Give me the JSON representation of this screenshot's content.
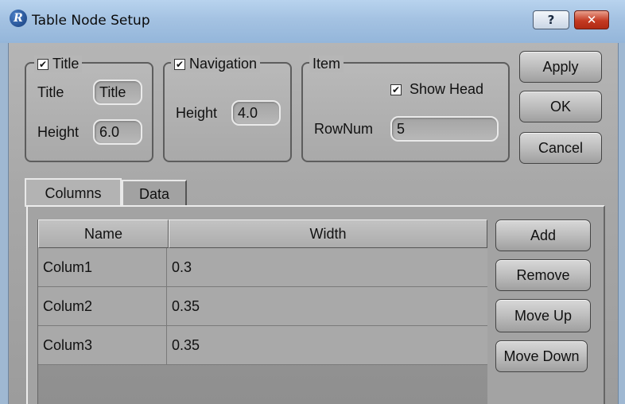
{
  "window": {
    "title": "Table Node Setup",
    "icon_letter": "R",
    "help_label": "?",
    "close_label": "✕"
  },
  "title_group": {
    "legend": "Title",
    "checked": true,
    "title_label": "Title",
    "title_value": "Title",
    "height_label": "Height",
    "height_value": "6.0"
  },
  "navigation_group": {
    "legend": "Navigation",
    "checked": true,
    "height_label": "Height",
    "height_value": "4.0"
  },
  "item_group": {
    "legend": "Item",
    "show_head_label": "Show Head",
    "show_head_checked": true,
    "rownum_label": "RowNum",
    "rownum_value": "5"
  },
  "actions": {
    "apply": "Apply",
    "ok": "OK",
    "cancel": "Cancel"
  },
  "tabs": [
    {
      "label": "Columns",
      "active": true
    },
    {
      "label": "Data",
      "active": false
    }
  ],
  "table": {
    "headers": [
      "Name",
      "Width"
    ],
    "rows": [
      [
        "Colum1",
        "0.3"
      ],
      [
        "Colum2",
        "0.35"
      ],
      [
        "Colum3",
        "0.35"
      ]
    ]
  },
  "table_buttons": {
    "add": "Add",
    "remove": "Remove",
    "move_up": "Move Up",
    "move_down": "Move Down"
  },
  "checkmark": "✔"
}
